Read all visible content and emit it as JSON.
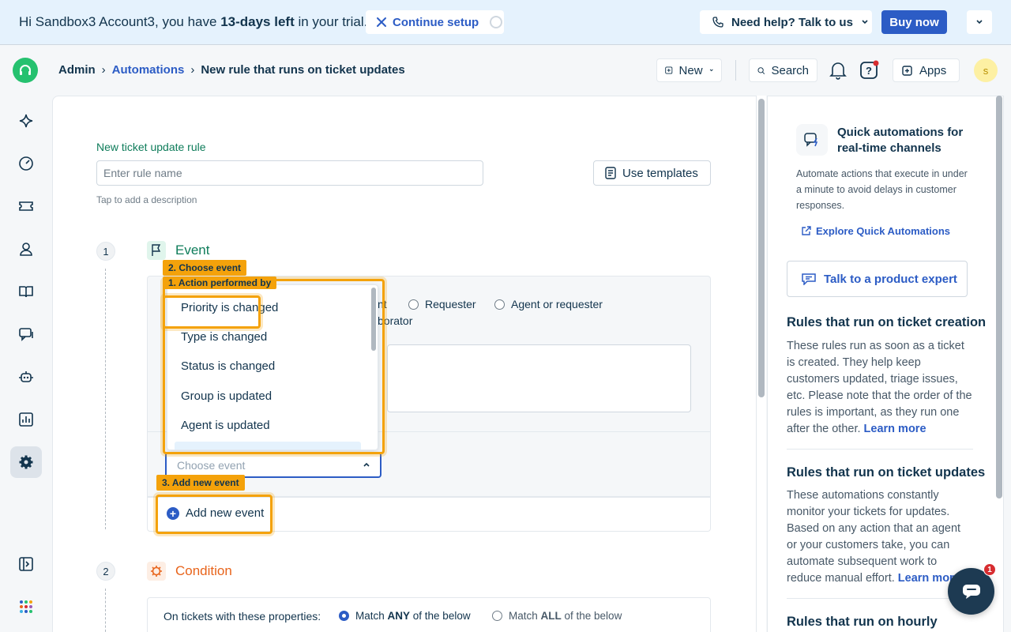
{
  "trial": {
    "greeting": "Hi Sandbox3 Account3, you have ",
    "days": "13-days left",
    "suffix": " in your trial.",
    "continue_label": "Continue setup",
    "help_label": "Need help? Talk to us",
    "buy_label": "Buy now"
  },
  "header": {
    "breadcrumb": [
      "Admin",
      "Automations",
      "New rule that runs on ticket updates"
    ],
    "new_label": "New",
    "search_label": "Search",
    "apps_label": "Apps",
    "avatar_initial": "s"
  },
  "form": {
    "rule_label": "New ticket update rule",
    "name_placeholder": "Enter rule name",
    "description_hint": "Tap to add a description",
    "templates_label": "Use templates"
  },
  "steps": {
    "event": {
      "number": "1",
      "title": "Event"
    },
    "condition": {
      "number": "2",
      "title": "Condition"
    }
  },
  "event": {
    "performer_partial": "nt",
    "performer_options": [
      "Requester",
      "Agent or requester"
    ],
    "collaborator_partial": "borator",
    "choose_placeholder": "Choose event",
    "add_new_label": "Add new event",
    "dropdown_items": [
      "Priority is changed",
      "Type is changed",
      "Status is changed",
      "Group is updated",
      "Agent is updated"
    ]
  },
  "tutorial": {
    "tag1": "1. Action performed by",
    "tag2": "2. Choose event",
    "tag3": "3. Add new event"
  },
  "condition": {
    "label": "On tickets with these properties:",
    "match_any_pre": "Match ",
    "match_any_bold": "ANY",
    "match_any_post": " of the below",
    "match_all_pre": "Match ",
    "match_all_bold": "ALL",
    "match_all_post": " of the below"
  },
  "right_panel": {
    "qa_title": "Quick automations for real-time channels",
    "qa_desc": "Automate actions that execute in under a minute to avoid delays in customer responses.",
    "qa_link": "Explore Quick Automations",
    "expert_label": "Talk to a product expert",
    "creation_heading": "Rules that run on ticket creation",
    "creation_text": "These rules run as soon as a ticket is created. They help keep customers updated, triage issues, etc. Please note that the order of the rules is important, as they run one after the other.",
    "creation_link": "Learn more",
    "updates_heading": "Rules that run on ticket updates",
    "updates_text": "These automations constantly monitor your tickets for updates. Based on any action that an agent or your customers take, you can automate subsequent work to reduce manual effort.",
    "updates_link": "Learn more",
    "hourly_heading": "Rules that run on hourly"
  },
  "chat": {
    "badge": "1"
  },
  "colors": {
    "accent": "#2c5cc5",
    "highlight": "#f4a20b",
    "event_green": "#0e7c5a",
    "condition_orange": "#e8641b"
  },
  "nav_icons": [
    "sparkle-icon",
    "dashboard-icon",
    "ticket-icon",
    "contact-icon",
    "book-icon",
    "conversation-icon",
    "bot-icon",
    "analytics-icon",
    "settings-icon",
    "expand-sidebar-icon",
    "apps-grid-icon"
  ]
}
